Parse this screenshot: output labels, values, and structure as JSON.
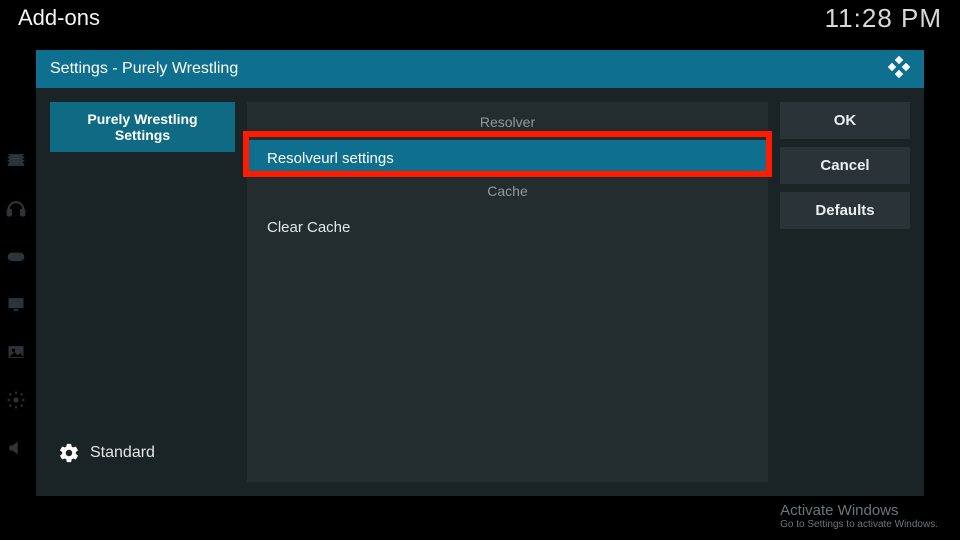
{
  "top": {
    "title": "Add-ons",
    "clock": "11:28 PM"
  },
  "dialog": {
    "title": "Settings - Purely Wrestling"
  },
  "categories": [
    {
      "label": "Purely Wrestling Settings",
      "selected": true
    }
  ],
  "level": {
    "label": "Standard"
  },
  "sections": [
    {
      "header": "Resolver",
      "items": [
        {
          "label": "Resolveurl settings",
          "selected": true,
          "highlighted": true
        }
      ]
    },
    {
      "header": "Cache",
      "items": [
        {
          "label": "Clear Cache",
          "selected": false
        }
      ]
    }
  ],
  "actions": {
    "ok": "OK",
    "cancel": "Cancel",
    "defaults": "Defaults"
  },
  "watermark": {
    "line1": "Activate Windows",
    "line2": "Go to Settings to activate Windows."
  },
  "rail_icons": [
    "movies",
    "music",
    "games",
    "tv",
    "photos",
    "settings",
    "audio"
  ]
}
